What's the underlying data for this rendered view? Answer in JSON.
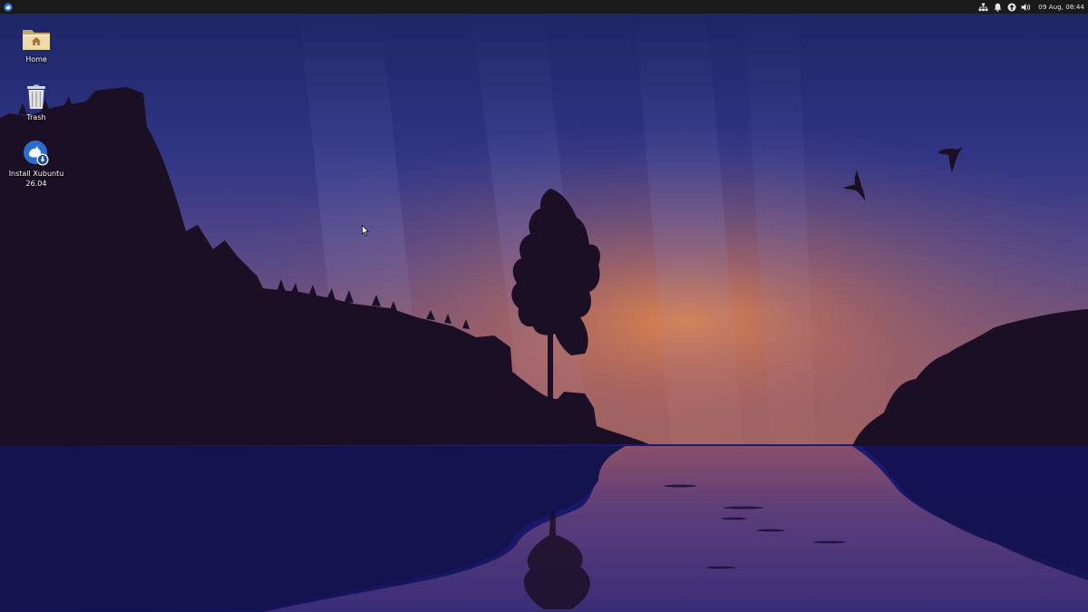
{
  "panel": {
    "menu_icon": "xubuntu-logo-icon",
    "tray_icons": [
      "network-icon",
      "notification-bell-icon",
      "update-icon",
      "volume-icon"
    ],
    "clock": "09 Aug, 08:44"
  },
  "desktop": {
    "icons": [
      {
        "label": "Home",
        "icon": "home-folder-icon"
      },
      {
        "label": "Trash",
        "icon": "trash-icon"
      },
      {
        "label": "Install Xubuntu 26.04",
        "icon": "installer-icon"
      }
    ]
  },
  "colors": {
    "panel_bg": "#1a1a1a",
    "sky_top": "#1c2461",
    "sky_glow": "#d9804a",
    "water": "#1a1a6e",
    "silhouette": "#1b0f26"
  }
}
